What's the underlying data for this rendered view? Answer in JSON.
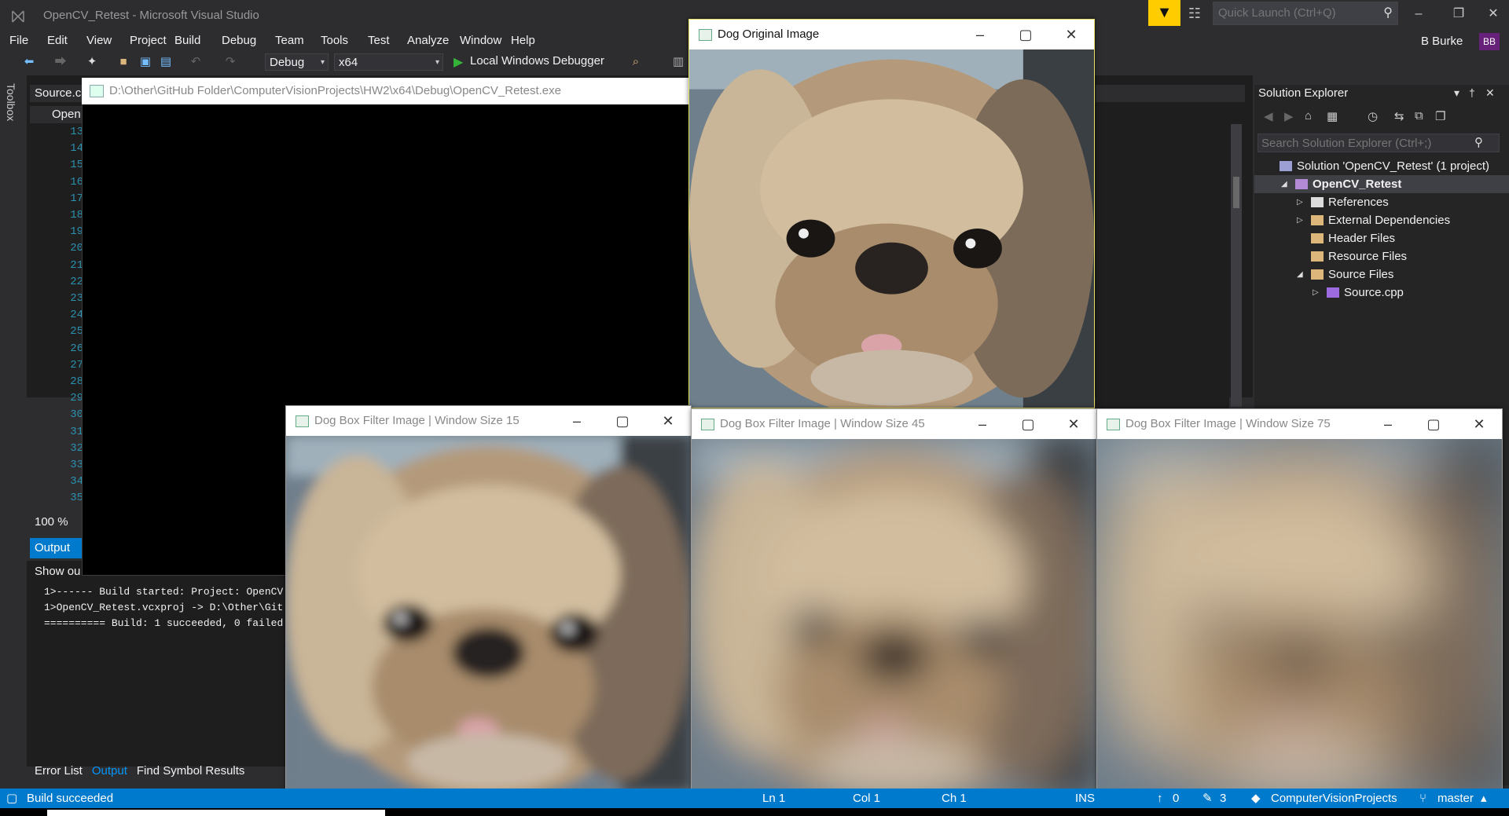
{
  "app": {
    "title": "OpenCV_Retest - Microsoft Visual Studio",
    "quick_launch_placeholder": "Quick Launch (Ctrl+Q)",
    "user_name": "B Burke",
    "user_initials": "BB"
  },
  "menu": [
    "File",
    "Edit",
    "View",
    "Project",
    "Build",
    "Debug",
    "Team",
    "Tools",
    "Test",
    "Analyze",
    "Window",
    "Help"
  ],
  "toolbar": {
    "configuration": "Debug",
    "platform": "x64",
    "debugger": "Local Windows Debugger"
  },
  "toolbox_label": "Toolbox",
  "editor": {
    "tab_label": "Source.cp",
    "nav_label": "Open",
    "line_numbers": [
      "13",
      "14",
      "15",
      "16",
      "17",
      "18",
      "19",
      "20",
      "21",
      "22",
      "23",
      "24",
      "25",
      "26",
      "27",
      "28",
      "29",
      "30",
      "31",
      "32",
      "33",
      "34",
      "35"
    ],
    "zoom": "100 %"
  },
  "output": {
    "header": "Output",
    "show_output_from": "Show ou",
    "lines": [
      "1>------ Build started: Project: OpenCV",
      "1>OpenCV_Retest.vcxproj -> D:\\Other\\Git",
      "========== Build: 1 succeeded, 0 failed"
    ]
  },
  "bottom_tabs": [
    {
      "label": "Error List",
      "active": false
    },
    {
      "label": "Output",
      "active": true
    },
    {
      "label": "Find Symbol Results",
      "active": false
    }
  ],
  "solution_explorer": {
    "title": "Solution Explorer",
    "search_placeholder": "Search Solution Explorer (Ctrl+;)",
    "tree": [
      {
        "label": "Solution 'OpenCV_Retest' (1 project)",
        "depth": 0,
        "expander": "",
        "icon": "solution-icon",
        "selected": false
      },
      {
        "label": "OpenCV_Retest",
        "depth": 1,
        "expander": "expanded",
        "icon": "project-icon",
        "selected": true
      },
      {
        "label": "References",
        "depth": 2,
        "expander": "collapsed",
        "icon": "references-icon",
        "selected": false
      },
      {
        "label": "External Dependencies",
        "depth": 2,
        "expander": "collapsed",
        "icon": "external-deps-icon",
        "selected": false
      },
      {
        "label": "Header Files",
        "depth": 2,
        "expander": "",
        "icon": "filter-folder-icon",
        "selected": false
      },
      {
        "label": "Resource Files",
        "depth": 2,
        "expander": "",
        "icon": "filter-folder-icon",
        "selected": false
      },
      {
        "label": "Source Files",
        "depth": 2,
        "expander": "expanded",
        "icon": "filter-folder-icon",
        "selected": false
      },
      {
        "label": "Source.cpp",
        "depth": 3,
        "expander": "collapsed",
        "icon": "cpp-file-icon",
        "selected": false
      }
    ]
  },
  "console": {
    "title": "D:\\Other\\GitHub Folder\\ComputerVisionProjects\\HW2\\x64\\Debug\\OpenCV_Retest.exe"
  },
  "image_windows": [
    {
      "title": "Dog Original Image",
      "blur": 0,
      "active": true
    },
    {
      "title": "Dog Box Filter Image | Window Size 15",
      "blur": 6,
      "active": false
    },
    {
      "title": "Dog Box Filter Image | Window Size 45",
      "blur": 18,
      "active": false
    },
    {
      "title": "Dog Box Filter Image | Window Size 75",
      "blur": 30,
      "active": false
    }
  ],
  "statusbar": {
    "status": "Build succeeded",
    "ln": "Ln 1",
    "col": "Col 1",
    "ch": "Ch 1",
    "mode": "INS",
    "push_count": "0",
    "changes_count": "3",
    "repo": "ComputerVisionProjects",
    "branch": "master"
  },
  "colors": {
    "accent": "#007acc",
    "background": "#2d2d30",
    "notification": "#ffcc00",
    "user_badge": "#68217a"
  }
}
